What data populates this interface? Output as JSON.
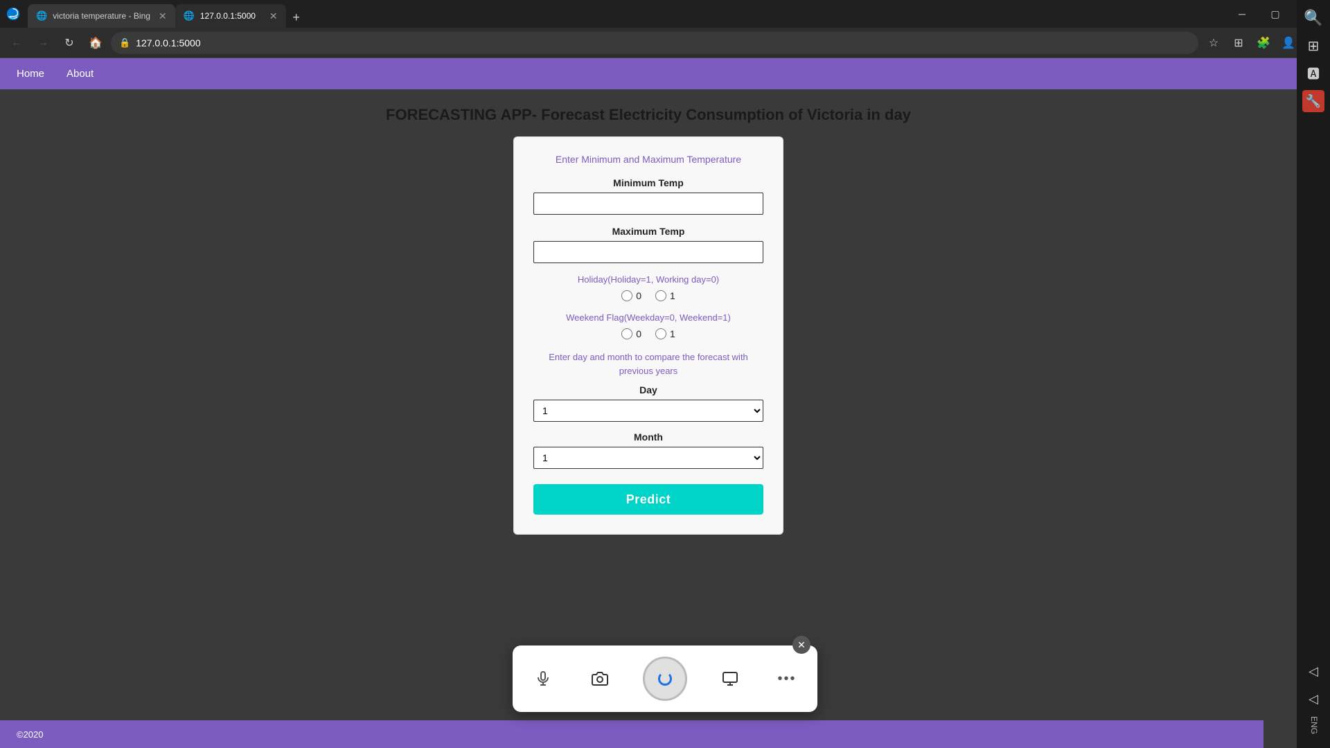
{
  "browser": {
    "tabs": [
      {
        "id": "tab-bing",
        "label": "victoria temperature - Bing",
        "active": false,
        "favicon": "🌐"
      },
      {
        "id": "tab-app",
        "label": "127.0.0.1:5000",
        "active": true,
        "favicon": "🌐"
      }
    ],
    "new_tab_label": "+",
    "address": "127.0.0.1:5000",
    "back_tooltip": "Back",
    "forward_tooltip": "Forward",
    "refresh_tooltip": "Refresh",
    "home_tooltip": "Home"
  },
  "navbar": {
    "items": [
      {
        "id": "nav-home",
        "label": "Home"
      },
      {
        "id": "nav-about",
        "label": "About"
      }
    ]
  },
  "page": {
    "title": "FORECASTING APP- Forecast Electricity Consumption of Victoria in day",
    "form": {
      "subtitle": "Enter Minimum and Maximum Temperature",
      "min_temp_label": "Minimum Temp",
      "min_temp_placeholder": "",
      "max_temp_label": "Maximum Temp",
      "max_temp_placeholder": "",
      "holiday_label": "Holiday(Holiday=1, Working day=0)",
      "holiday_options": [
        {
          "value": "0",
          "label": "0"
        },
        {
          "value": "1",
          "label": "1"
        }
      ],
      "weekend_label": "Weekend Flag(Weekday=0, Weekend=1)",
      "weekend_options": [
        {
          "value": "0",
          "label": "0"
        },
        {
          "value": "1",
          "label": "1"
        }
      ],
      "day_month_subtitle": "Enter day and month to compare the forecast with previous years",
      "day_label": "Day",
      "day_value": "1",
      "month_label": "Month",
      "month_value": "1",
      "predict_button": "Predict"
    }
  },
  "footer": {
    "copyright": "©2020"
  },
  "media_toolbar": {
    "close_label": "×",
    "microphone_icon": "🎤",
    "camera_icon": "📷",
    "screen_icon": "🖥",
    "more_icon": "•••"
  }
}
